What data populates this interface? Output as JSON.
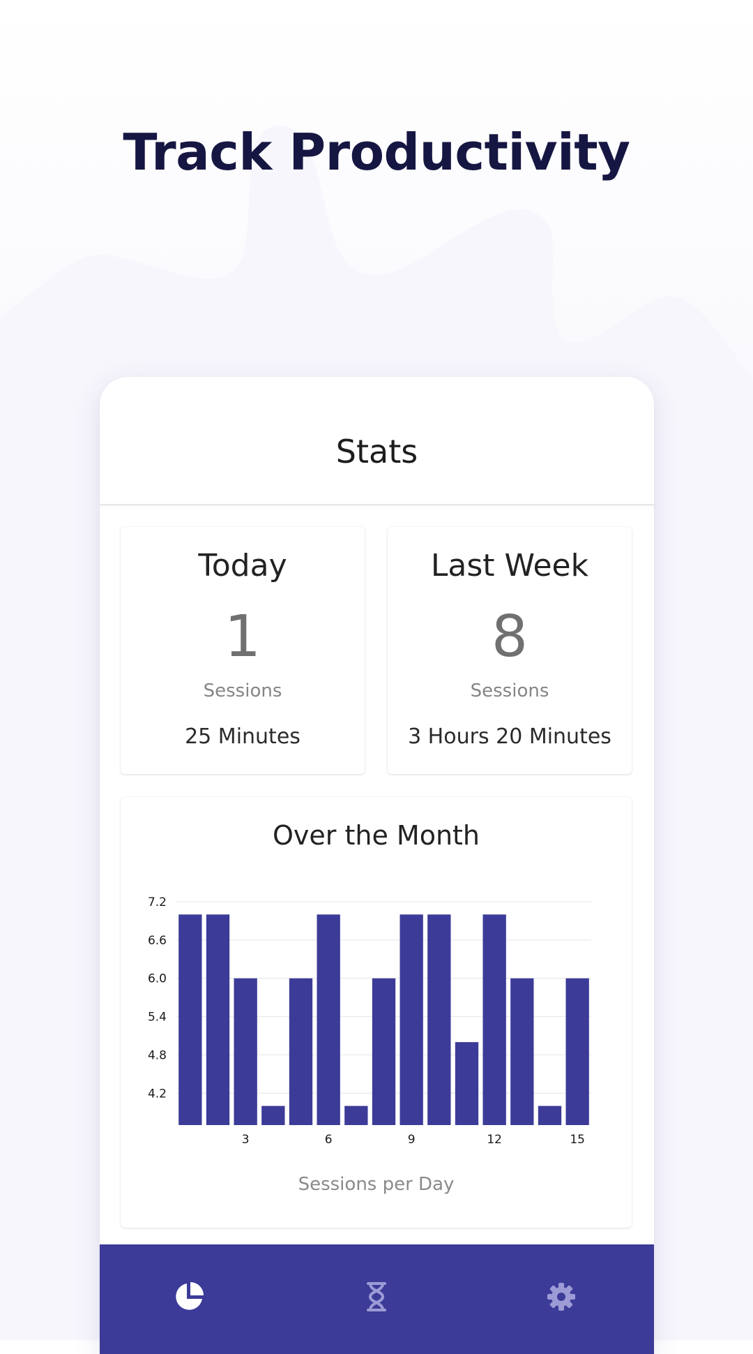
{
  "headline": "Track Productivity",
  "colors": {
    "primary": "#3c3b98",
    "headline": "#161642",
    "bar": "#3c3b98",
    "nav_active_icon": "#ffffff",
    "nav_inactive_icon": "#9c9bd6"
  },
  "app_bar": {
    "title": "Stats"
  },
  "today": {
    "title": "Today",
    "count": "1",
    "unit": "Sessions",
    "duration": "25 Minutes"
  },
  "last_week": {
    "title": "Last Week",
    "count": "8",
    "unit": "Sessions",
    "duration": "3 Hours 20 Minutes"
  },
  "month": {
    "title": "Over the Month",
    "xlabel": "Sessions per Day"
  },
  "chart_data": {
    "type": "bar",
    "title": "Over the Month",
    "xlabel": "Sessions per Day",
    "ylabel": "",
    "x": [
      1,
      2,
      3,
      4,
      5,
      6,
      7,
      8,
      9,
      10,
      11,
      12,
      13,
      14,
      15
    ],
    "values": [
      7,
      7,
      6,
      4,
      6,
      7,
      4,
      6,
      7,
      7,
      5,
      7,
      6,
      4,
      6
    ],
    "x_tick_labels": [
      "3",
      "6",
      "9",
      "12",
      "15"
    ],
    "y_tick_labels": [
      "4.2",
      "4.8",
      "5.4",
      "6.0",
      "6.6",
      "7.2"
    ],
    "ylim": [
      3.7,
      7.2
    ],
    "grid": true,
    "legend": "none"
  },
  "bottom_nav": {
    "items": [
      {
        "icon": "pie-chart-icon",
        "active": true
      },
      {
        "icon": "hourglass-icon",
        "active": false
      },
      {
        "icon": "gear-icon",
        "active": false
      }
    ]
  }
}
